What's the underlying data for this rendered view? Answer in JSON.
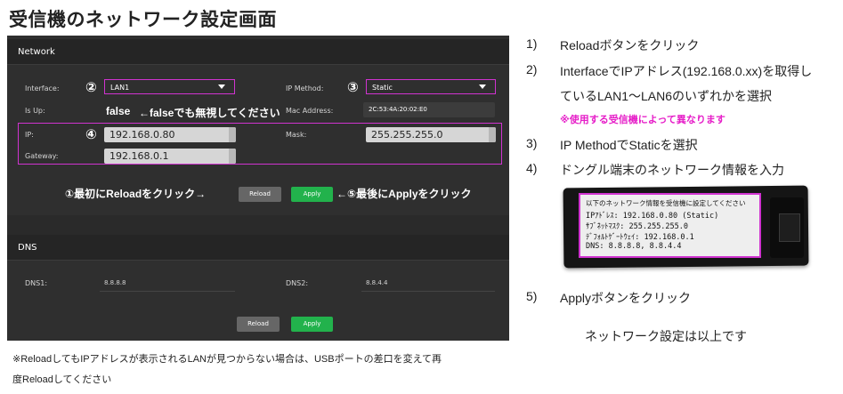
{
  "page_title": "受信機のネットワーク設定画面",
  "network": {
    "section_title": "Network",
    "interface_label": "Interface:",
    "interface_value": "LAN1",
    "ip_method_label": "IP Method:",
    "ip_method_value": "Static",
    "is_up_label": "Is Up:",
    "is_up_value": "false",
    "is_up_note": "←falseでも無視してください",
    "mac_label": "Mac Address:",
    "mac_value": "2C:53:4A:20:02:E0",
    "ip_label": "IP:",
    "ip_value": "192.168.0.80",
    "mask_label": "Mask:",
    "mask_value": "255.255.255.0",
    "gateway_label": "Gateway:",
    "gateway_value": "192.168.0.1",
    "num2": "②",
    "num3": "③",
    "num4": "④",
    "anno_reload": "①最初にReloadをクリック→",
    "anno_apply": "←⑤最後にApplyをクリック",
    "reload_label": "Reload",
    "apply_label": "Apply"
  },
  "dns": {
    "section_title": "DNS",
    "dns1_label": "DNS1:",
    "dns1_value": "8.8.8.8",
    "dns2_label": "DNS2:",
    "dns2_value": "8.8.4.4",
    "reload_label": "Reload",
    "apply_label": "Apply"
  },
  "footnote": {
    "line1": "※ReloadしてもIPアドレスが表示されるLANが見つからない場合は、USBポートの差口を変えて再",
    "line2": "度Reloadしてください"
  },
  "steps": [
    {
      "num": "1)",
      "text": "Reloadボタンをクリック"
    },
    {
      "num": "2)",
      "text": "InterfaceでIPアドレス(192.168.0.xx)を取得し"
    },
    {
      "num": "",
      "text": "ているLAN1～LAN6のいずれかを選択"
    },
    {
      "num": "3)",
      "text": "IP MethodでStaticを選択"
    },
    {
      "num": "4)",
      "text": "ドングル端末のネットワーク情報を入力"
    },
    {
      "num": "5)",
      "text": "Applyボタンをクリック"
    }
  ],
  "step_note": "※使用する受信機によって異なります",
  "closing_text": "ネットワーク設定は以上です",
  "dongle_screen": {
    "line1": "以下のネットワーク情報を受信機に設定してください",
    "line2": "IPｱﾄﾞﾚｽ: 192.168.0.80 (Static)",
    "line3": "ｻﾌﾞﾈｯﾄﾏｽｸ: 255.255.255.0",
    "line4": "ﾃﾞﾌｫﾙﾄｹﾞｰﾄｳｪｲ: 192.168.0.1",
    "line5": "DNS: 8.8.8.8, 8.8.4.4"
  },
  "colors": {
    "highlight": "#d033d0",
    "apply_green": "#22b24c",
    "note_pink": "#e61ec8",
    "panel_bg": "#2f2f2f"
  }
}
